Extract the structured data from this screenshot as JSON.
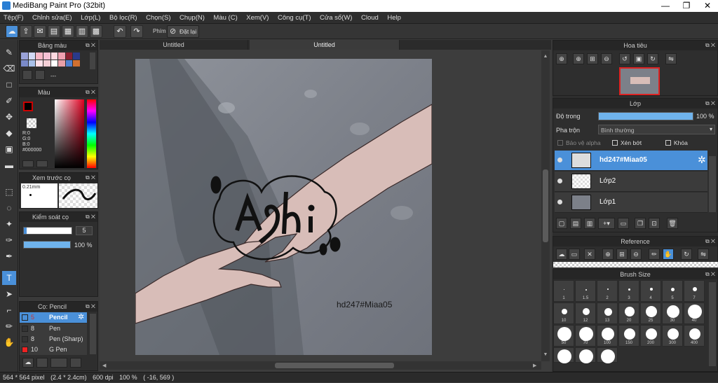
{
  "window": {
    "title": "MediBang Paint Pro (32bit)"
  },
  "menu": [
    "Tệp(F)",
    "Chỉnh sửa(E)",
    "Lớp(L)",
    "Bộ lọc(R)",
    "Chọn(S)",
    "Chụp(N)",
    "Màu (C)",
    "Xem(V)",
    "Công cụ(T)",
    "Cửa sổ(W)",
    "Cloud",
    "Help"
  ],
  "toolbar": {
    "shortcut_label": "Phím",
    "reset_label": "Đặt lại"
  },
  "tabs": [
    "Untitled",
    "Untitled"
  ],
  "palette": {
    "title": "Bảng màu",
    "dashes": "---"
  },
  "color": {
    "title": "Màu",
    "r": "R:0",
    "g": "G:0",
    "b": "B:0",
    "hex": "#000000"
  },
  "preview": {
    "title": "Xem trước cọ",
    "size": "0.21mm"
  },
  "brushctl": {
    "title": "Kiểm soát cọ",
    "size_value": "5",
    "opacity_value": "100 %"
  },
  "brushes": {
    "title": "Cọ: Pencil",
    "items": [
      {
        "size": "5",
        "name": "Pencil"
      },
      {
        "size": "8",
        "name": "Pen"
      },
      {
        "size": "8",
        "name": "Pen (Sharp)"
      },
      {
        "size": "10",
        "name": "G Pen"
      }
    ]
  },
  "canvas": {
    "watermark": "hd247#Miaa05"
  },
  "navigator": {
    "title": "Hoa tiêu"
  },
  "layers": {
    "title": "Lớp",
    "opacity_label": "Độ trong",
    "opacity_value": "100 %",
    "blend_label": "Pha trộn",
    "blend_value": "Bình thường",
    "protect_alpha": "Bảo vệ alpha",
    "clipping": "Xén bớt",
    "lock": "Khóa",
    "items": [
      {
        "name": "hd247#Miaa05"
      },
      {
        "name": "Lớp2"
      },
      {
        "name": "Lớp1"
      }
    ]
  },
  "reference": {
    "title": "Reference"
  },
  "brushsize": {
    "title": "Brush Size",
    "sizes": [
      "1",
      "1.5",
      "2",
      "3",
      "4",
      "5",
      "7",
      "10",
      "12",
      "13",
      "20",
      "25",
      "30",
      "40",
      "50",
      "70",
      "100",
      "150",
      "200",
      "300",
      "400"
    ]
  },
  "status": {
    "dims": "564 * 564 pixel",
    "physical": "(2.4 * 2.4cm)",
    "dpi": "600 dpi",
    "zoom": "100 %",
    "coords": "( -16, 569 )"
  }
}
